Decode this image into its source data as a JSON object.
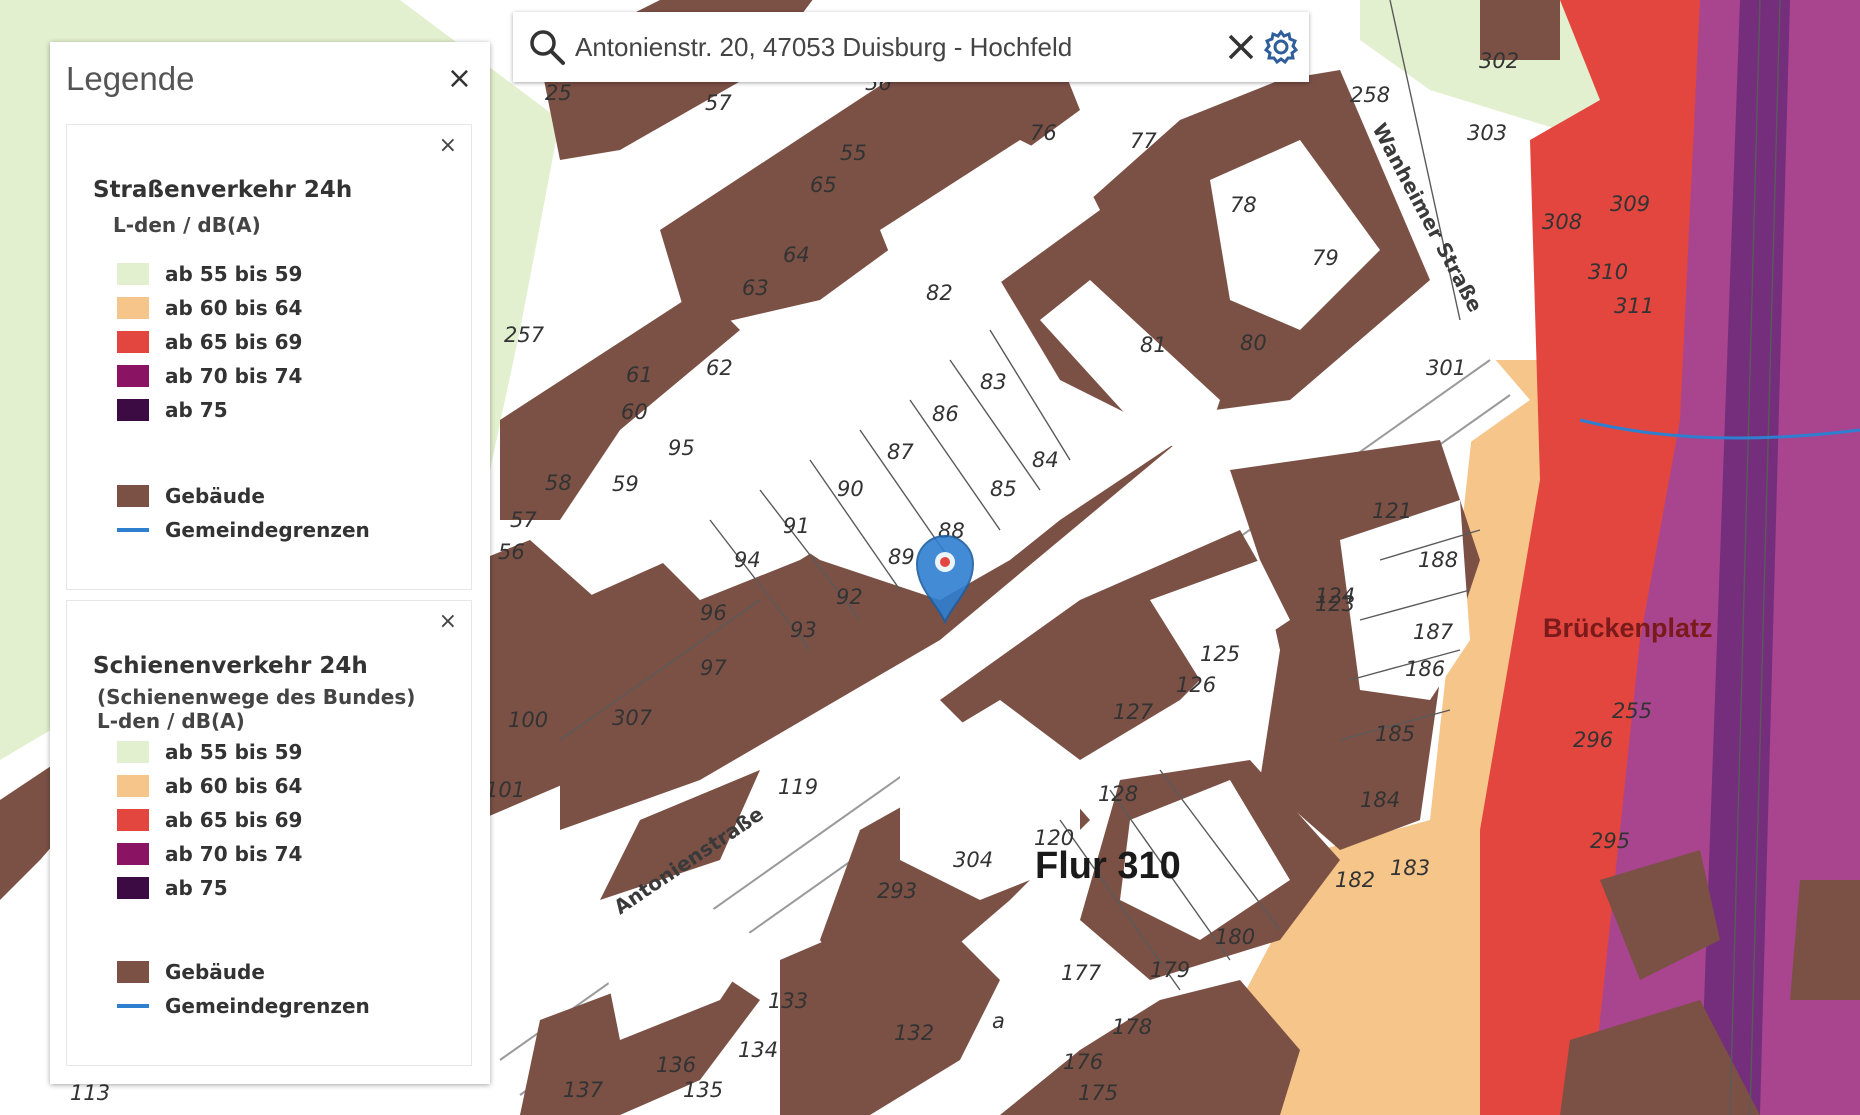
{
  "search": {
    "value": "Antonienstr. 20, 47053 Duisburg - Hochfeld",
    "clear_icon": "close-icon",
    "settings_icon": "gear-icon",
    "search_icon": "search-icon"
  },
  "legend": {
    "title": "Legende",
    "close_label": "×",
    "sections": [
      {
        "title": "Straßenverkehr 24h",
        "subtitle": "",
        "unit": "L-den / dB(A)",
        "classes": [
          {
            "label": "ab 55 bis 59",
            "color": "#e3f0cf"
          },
          {
            "label": "ab 60 bis 64",
            "color": "#f5c58a"
          },
          {
            "label": "ab 65 bis 69",
            "color": "#e2463f"
          },
          {
            "label": "ab 70 bis 74",
            "color": "#8a1463"
          },
          {
            "label": "ab 75",
            "color": "#3c0b44"
          }
        ],
        "extra": [
          {
            "label": "Gebäude",
            "color": "#7b5045",
            "kind": "box"
          },
          {
            "label": "Gemeindegrenzen",
            "color": "#2f7fd1",
            "kind": "line"
          }
        ]
      },
      {
        "title": "Schienenverkehr 24h",
        "subtitle": "(Schienenwege des Bundes)",
        "unit": "L-den / dB(A)",
        "classes": [
          {
            "label": "ab 55 bis 59",
            "color": "#e3f0cf"
          },
          {
            "label": "ab 60 bis 64",
            "color": "#f5c58a"
          },
          {
            "label": "ab 65 bis 69",
            "color": "#e2463f"
          },
          {
            "label": "ab 70 bis 74",
            "color": "#8a1463"
          },
          {
            "label": "ab 75",
            "color": "#3c0b44"
          }
        ],
        "extra": [
          {
            "label": "Gebäude",
            "color": "#7b5045",
            "kind": "box"
          },
          {
            "label": "Gemeindegrenzen",
            "color": "#2f7fd1",
            "kind": "line"
          }
        ]
      }
    ]
  },
  "map": {
    "streets": [
      "Antonienstraße",
      "Wanheimer Straße"
    ],
    "flur": "Flur 310",
    "place": "Brückenplatz",
    "parcels": [
      "25",
      "57",
      "56",
      "55",
      "76",
      "77",
      "258",
      "65",
      "64",
      "78",
      "63",
      "82",
      "79",
      "80",
      "62",
      "81",
      "61",
      "257",
      "60",
      "95",
      "83",
      "86",
      "59",
      "58",
      "87",
      "84",
      "90",
      "85",
      "57",
      "91",
      "88",
      "56",
      "94",
      "89",
      "96",
      "92",
      "93",
      "97",
      "307",
      "100",
      "101",
      "119",
      "304",
      "120",
      "128",
      "293",
      "183",
      "182",
      "184",
      "185",
      "186",
      "187",
      "188",
      "121",
      "123",
      "124",
      "125",
      "126",
      "127",
      "180",
      "179",
      "177",
      "178",
      "176",
      "175",
      "133",
      "134",
      "132",
      "136",
      "135",
      "137",
      "113",
      "301",
      "296",
      "295",
      "255",
      "302",
      "303",
      "308",
      "309",
      "310",
      "311",
      "a"
    ],
    "colors": {
      "building": "#7b5045",
      "noise_55": "#e3f0cf",
      "noise_60": "#f5c58a",
      "noise_65": "#e2463f",
      "noise_70": "#8a1463",
      "noise_75": "#3c0b44",
      "marker": "#2f7fd1"
    },
    "marker_icon": "map-pin-icon"
  }
}
